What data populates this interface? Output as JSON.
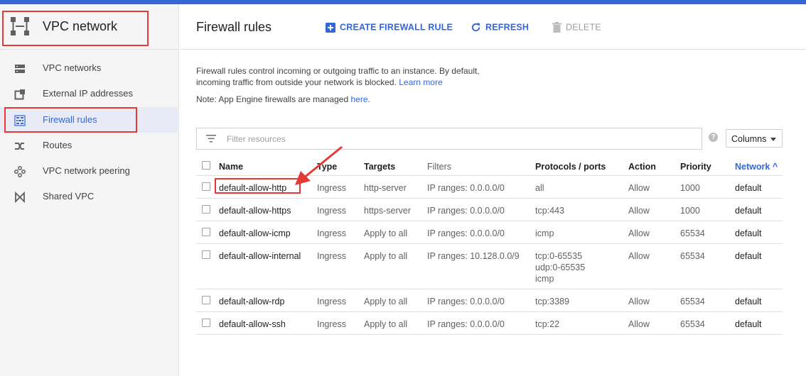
{
  "sidebar": {
    "title": "VPC network",
    "items": [
      {
        "label": "VPC networks",
        "icon": "vpc-networks-icon"
      },
      {
        "label": "External IP addresses",
        "icon": "external-ip-icon"
      },
      {
        "label": "Firewall rules",
        "icon": "firewall-icon"
      },
      {
        "label": "Routes",
        "icon": "routes-icon"
      },
      {
        "label": "VPC network peering",
        "icon": "peering-icon"
      },
      {
        "label": "Shared VPC",
        "icon": "shared-vpc-icon"
      }
    ]
  },
  "header": {
    "title": "Firewall rules",
    "create_label": "CREATE FIREWALL RULE",
    "refresh_label": "REFRESH",
    "delete_label": "DELETE"
  },
  "description": {
    "line1": "Firewall rules control incoming or outgoing traffic to an instance. By default,",
    "line2": "incoming traffic from outside your network is blocked.",
    "learn_more": "Learn more",
    "note": "Note: App Engine firewalls are managed",
    "here": "here",
    "period": "."
  },
  "filter": {
    "placeholder": "Filter resources",
    "help": "?",
    "columns_label": "Columns"
  },
  "table": {
    "headers": {
      "name": "Name",
      "type": "Type",
      "targets": "Targets",
      "filters": "Filters",
      "protocols": "Protocols / ports",
      "action": "Action",
      "priority": "Priority",
      "network": "Network"
    },
    "sort_indicator": "^",
    "rows": [
      {
        "name": "default-allow-http",
        "type": "Ingress",
        "targets": "http-server",
        "filters": "IP ranges: 0.0.0.0/0",
        "protocols": [
          "all"
        ],
        "action": "Allow",
        "priority": "1000",
        "network": "default"
      },
      {
        "name": "default-allow-https",
        "type": "Ingress",
        "targets": "https-server",
        "filters": "IP ranges: 0.0.0.0/0",
        "protocols": [
          "tcp:443"
        ],
        "action": "Allow",
        "priority": "1000",
        "network": "default"
      },
      {
        "name": "default-allow-icmp",
        "type": "Ingress",
        "targets": "Apply to all",
        "filters": "IP ranges: 0.0.0.0/0",
        "protocols": [
          "icmp"
        ],
        "action": "Allow",
        "priority": "65534",
        "network": "default"
      },
      {
        "name": "default-allow-internal",
        "type": "Ingress",
        "targets": "Apply to all",
        "filters": "IP ranges: 10.128.0.0/9",
        "protocols": [
          "tcp:0-65535",
          "udp:0-65535",
          "icmp"
        ],
        "action": "Allow",
        "priority": "65534",
        "network": "default"
      },
      {
        "name": "default-allow-rdp",
        "type": "Ingress",
        "targets": "Apply to all",
        "filters": "IP ranges: 0.0.0.0/0",
        "protocols": [
          "tcp:3389"
        ],
        "action": "Allow",
        "priority": "65534",
        "network": "default"
      },
      {
        "name": "default-allow-ssh",
        "type": "Ingress",
        "targets": "Apply to all",
        "filters": "IP ranges: 0.0.0.0/0",
        "protocols": [
          "tcp:22"
        ],
        "action": "Allow",
        "priority": "65534",
        "network": "default"
      }
    ]
  },
  "colors": {
    "accent": "#3367d6",
    "annotation": "#e53935"
  }
}
